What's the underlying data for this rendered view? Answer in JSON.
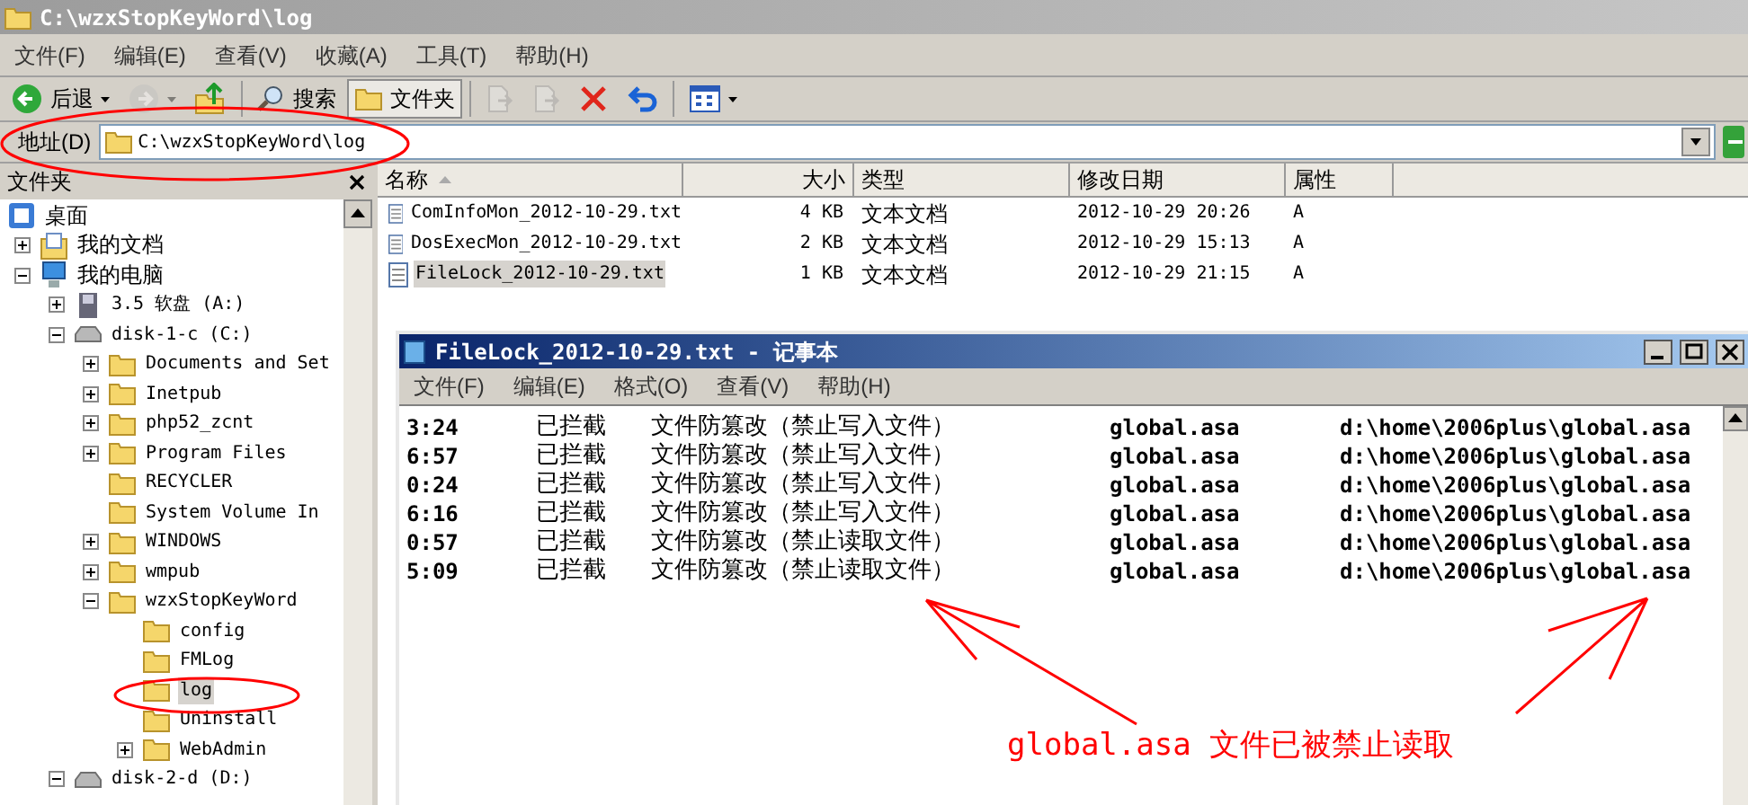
{
  "window": {
    "title": "C:\\wzxStopKeyWord\\log"
  },
  "menu": [
    {
      "label": "文件(F)"
    },
    {
      "label": "编辑(E)"
    },
    {
      "label": "查看(V)"
    },
    {
      "label": "收藏(A)"
    },
    {
      "label": "工具(T)"
    },
    {
      "label": "帮助(H)"
    }
  ],
  "toolbar": [
    {
      "kind": "back",
      "label": "后退",
      "has_menu": true,
      "disabled": false,
      "pressed": false
    },
    {
      "kind": "forward",
      "has_menu": true,
      "disabled": true,
      "pressed": false
    },
    {
      "kind": "up",
      "has_menu": false,
      "disabled": false,
      "pressed": false
    },
    {
      "kind": "separator"
    },
    {
      "kind": "search",
      "label": "搜索",
      "has_menu": false,
      "disabled": false,
      "pressed": false
    },
    {
      "kind": "folders",
      "label": "文件夹",
      "has_menu": false,
      "disabled": false,
      "pressed": true
    },
    {
      "kind": "separator"
    },
    {
      "kind": "move",
      "has_menu": false,
      "disabled": true,
      "pressed": false
    },
    {
      "kind": "copy",
      "has_menu": false,
      "disabled": true,
      "pressed": false
    },
    {
      "kind": "delete",
      "has_menu": false,
      "disabled": false,
      "pressed": false
    },
    {
      "kind": "undo",
      "has_menu": false,
      "disabled": false,
      "pressed": false
    },
    {
      "kind": "separator"
    },
    {
      "kind": "views",
      "has_menu": true,
      "disabled": false,
      "pressed": false
    }
  ],
  "address": {
    "label": "地址(D)",
    "value": "C:\\wzxStopKeyWord\\log"
  },
  "folder_pane": {
    "title": "文件夹",
    "tree": [
      {
        "label": "桌面",
        "kind": "desktop",
        "selected": false,
        "children": [
          {
            "label": "我的文档",
            "kind": "documents",
            "expanded": false,
            "selected": false
          },
          {
            "label": "我的电脑",
            "kind": "computer",
            "expanded": true,
            "selected": false,
            "children": [
              {
                "label": "3.5 软盘 (A:)",
                "kind": "floppy",
                "expanded": false,
                "selected": false
              },
              {
                "label": "disk-1-c (C:)",
                "kind": "drive",
                "expanded": true,
                "selected": false,
                "children": [
                  {
                    "label": "Documents and Set",
                    "kind": "folder",
                    "expanded": false,
                    "selected": false
                  },
                  {
                    "label": "Inetpub",
                    "kind": "folder",
                    "expanded": false,
                    "selected": false
                  },
                  {
                    "label": "php52_zcnt",
                    "kind": "folder",
                    "expanded": false,
                    "selected": false
                  },
                  {
                    "label": "Program Files",
                    "kind": "folder",
                    "expanded": false,
                    "selected": false
                  },
                  {
                    "label": "RECYCLER",
                    "kind": "folder",
                    "selected": false
                  },
                  {
                    "label": "System Volume In",
                    "kind": "folder",
                    "selected": false
                  },
                  {
                    "label": "WINDOWS",
                    "kind": "folder",
                    "expanded": false,
                    "selected": false
                  },
                  {
                    "label": "wmpub",
                    "kind": "folder",
                    "expanded": false,
                    "selected": false
                  },
                  {
                    "label": "wzxStopKeyWord",
                    "kind": "folder",
                    "expanded": true,
                    "selected": false,
                    "children": [
                      {
                        "label": "config",
                        "kind": "folder",
                        "selected": false
                      },
                      {
                        "label": "FMLog",
                        "kind": "folder",
                        "selected": false
                      },
                      {
                        "label": "log",
                        "kind": "folder",
                        "selected": true
                      },
                      {
                        "label": "Uninstall",
                        "kind": "folder",
                        "selected": false
                      },
                      {
                        "label": "WebAdmin",
                        "kind": "folder",
                        "expanded": false,
                        "selected": false
                      }
                    ]
                  }
                ]
              },
              {
                "label": "disk-2-d (D:)",
                "kind": "drive",
                "expanded": true,
                "selected": false
              }
            ]
          }
        ]
      }
    ]
  },
  "file_list": {
    "columns": [
      {
        "label": "名称",
        "sorted": true
      },
      {
        "label": "大小",
        "sorted": false
      },
      {
        "label": "类型",
        "sorted": false
      },
      {
        "label": "修改日期",
        "sorted": false
      },
      {
        "label": "属性",
        "sorted": false
      }
    ],
    "rows": [
      {
        "name": "ComInfoMon_2012-10-29.txt",
        "size": "4 KB",
        "type": "文本文档",
        "modified": "2012-10-29 20:26",
        "attributes": "A",
        "selected": false
      },
      {
        "name": "DosExecMon_2012-10-29.txt",
        "size": "2 KB",
        "type": "文本文档",
        "modified": "2012-10-29 15:13",
        "attributes": "A",
        "selected": false
      },
      {
        "name": "FileLock_2012-10-29.txt",
        "size": "1 KB",
        "type": "文本文档",
        "modified": "2012-10-29 21:15",
        "attributes": "A",
        "selected": true
      }
    ]
  },
  "notepad": {
    "title": "FileLock_2012-10-29.txt - 记事本",
    "menu": [
      {
        "label": "文件(F)"
      },
      {
        "label": "编辑(E)"
      },
      {
        "label": "格式(O)"
      },
      {
        "label": "查看(V)"
      },
      {
        "label": "帮助(H)"
      }
    ],
    "lines": [
      {
        "time": "3:24",
        "status": "已拦截",
        "rule": "文件防篡改（禁止写入文件）",
        "file": "global.asa",
        "path": "d:\\home\\2006plus\\global.asa"
      },
      {
        "time": "6:57",
        "status": "已拦截",
        "rule": "文件防篡改（禁止写入文件）",
        "file": "global.asa",
        "path": "d:\\home\\2006plus\\global.asa"
      },
      {
        "time": "0:24",
        "status": "已拦截",
        "rule": "文件防篡改（禁止写入文件）",
        "file": "global.asa",
        "path": "d:\\home\\2006plus\\global.asa"
      },
      {
        "time": "6:16",
        "status": "已拦截",
        "rule": "文件防篡改（禁止写入文件）",
        "file": "global.asa",
        "path": "d:\\home\\2006plus\\global.asa"
      },
      {
        "time": "0:57",
        "status": "已拦截",
        "rule": "文件防篡改（禁止读取文件）",
        "file": "global.asa",
        "path": "d:\\home\\2006plus\\global.asa"
      },
      {
        "time": "5:09",
        "status": "已拦截",
        "rule": "文件防篡改（禁止读取文件）",
        "file": "global.asa",
        "path": "d:\\home\\2006plus\\global.asa"
      }
    ]
  },
  "annotation": {
    "text": "global.asa 文件已被禁止读取"
  }
}
